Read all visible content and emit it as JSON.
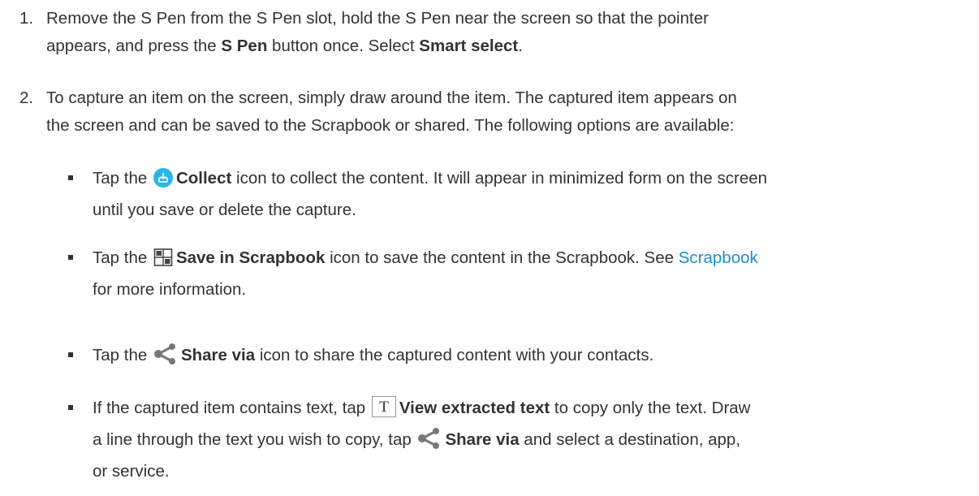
{
  "steps": [
    {
      "number": "1.",
      "line1_a": "Remove the S Pen from the S Pen slot, hold the S Pen near the screen so that the pointer",
      "line2_a": "appears, and press the ",
      "line2_b": "S Pen",
      "line2_c": " button once. Select ",
      "line2_d": "Smart select",
      "line2_e": "."
    },
    {
      "number": "2.",
      "line1": "To capture an item on the screen, simply draw around the item. The captured item appears on",
      "line2": "the screen and can be saved to the Scrapbook or shared. The following options are available:"
    }
  ],
  "bullets": {
    "collect": {
      "pre": "Tap the ",
      "bold": "Collect",
      "post": " icon to collect the content. It will appear in minimized form on the screen",
      "line2": "until you save or delete the capture.",
      "icon": "collect-icon",
      "color": "#2bb5e8"
    },
    "scrapbook": {
      "pre": "Tap the ",
      "bold": "Save in Scrapbook",
      "post": " icon to save the content in the Scrapbook. See ",
      "link": "Scrapbook",
      "line2": "for more information.",
      "icon": "scrapbook-icon",
      "link_color": "#1b8fc4"
    },
    "share": {
      "pre": "Tap the ",
      "bold": "Share via",
      "post": " icon to share the captured content with your contacts.",
      "icon": "share-icon"
    },
    "extract": {
      "pre": "If the captured item contains text, tap ",
      "bold": "View extracted text",
      "post": " to copy only the text. Draw",
      "line2_pre": "a line through the text you wish to copy, tap ",
      "line2_bold": "Share via",
      "line2_post": " and select a destination, app,",
      "line3": "or service.",
      "icon": "text-extract-icon"
    }
  }
}
